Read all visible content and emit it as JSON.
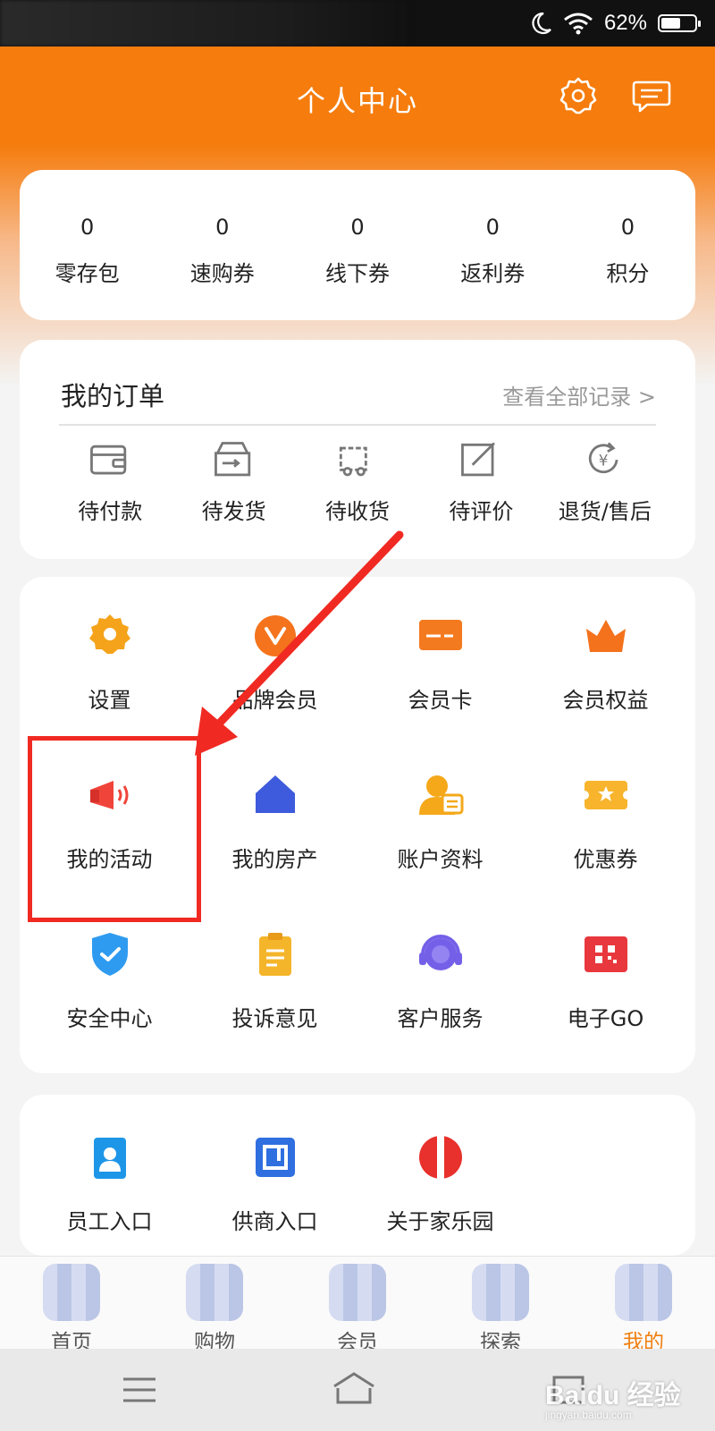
{
  "status_bar": {
    "battery": "62%",
    "battery_level": 0.62
  },
  "header": {
    "title": "个人中心",
    "icons": [
      "gear-icon",
      "message-icon"
    ]
  },
  "stats": [
    {
      "value": "0",
      "label": "零存包"
    },
    {
      "value": "0",
      "label": "速购券"
    },
    {
      "value": "0",
      "label": "线下券"
    },
    {
      "value": "0",
      "label": "返利券"
    },
    {
      "value": "0",
      "label": "积分"
    }
  ],
  "orders": {
    "title": "我的订单",
    "view_all": "查看全部记录 >",
    "items": [
      {
        "label": "待付款",
        "icon": "wallet-icon"
      },
      {
        "label": "待发货",
        "icon": "box-icon"
      },
      {
        "label": "待收货",
        "icon": "truck-icon"
      },
      {
        "label": "待评价",
        "icon": "edit-icon"
      },
      {
        "label": "退货/售后",
        "icon": "refund-icon"
      }
    ]
  },
  "services": [
    {
      "label": "设置",
      "icon": "gear-icon",
      "color": "#f5a31a"
    },
    {
      "label": "品牌会员",
      "icon": "brand-member-icon",
      "color": "#f4731c"
    },
    {
      "label": "会员卡",
      "icon": "member-card-icon",
      "color": "#f47a1f"
    },
    {
      "label": "会员权益",
      "icon": "crown-icon",
      "color": "#f4721c"
    },
    {
      "label": "我的活动",
      "icon": "megaphone-icon",
      "color": "#f0443a"
    },
    {
      "label": "我的房产",
      "icon": "house-icon",
      "color": "#3d5bdc"
    },
    {
      "label": "账户资料",
      "icon": "account-icon",
      "color": "#f5a81a"
    },
    {
      "label": "优惠券",
      "icon": "coupon-icon",
      "color": "#f7b42c"
    },
    {
      "label": "安全中心",
      "icon": "shield-icon",
      "color": "#2e9bf0"
    },
    {
      "label": "投诉意见",
      "icon": "clipboard-icon",
      "color": "#f5b52a"
    },
    {
      "label": "客户服务",
      "icon": "headset-icon",
      "color": "#7460e8"
    },
    {
      "label": "电子GO",
      "icon": "qr-card-icon",
      "color": "#e8383d"
    }
  ],
  "extra": [
    {
      "label": "员工入口",
      "icon": "badge-icon",
      "color": "#1e96e8"
    },
    {
      "label": "供商入口",
      "icon": "supplier-icon",
      "color": "#2f6fe0"
    },
    {
      "label": "关于家乐园",
      "icon": "brand-logo-icon",
      "color": "#e8302c"
    }
  ],
  "tabbar": [
    {
      "label": "首页",
      "active": false
    },
    {
      "label": "购物",
      "active": false
    },
    {
      "label": "会员",
      "active": false
    },
    {
      "label": "探索",
      "active": false
    },
    {
      "label": "我的",
      "active": true
    }
  ],
  "accent_color": "#f57c0d",
  "annotation_color": "#f02a22"
}
